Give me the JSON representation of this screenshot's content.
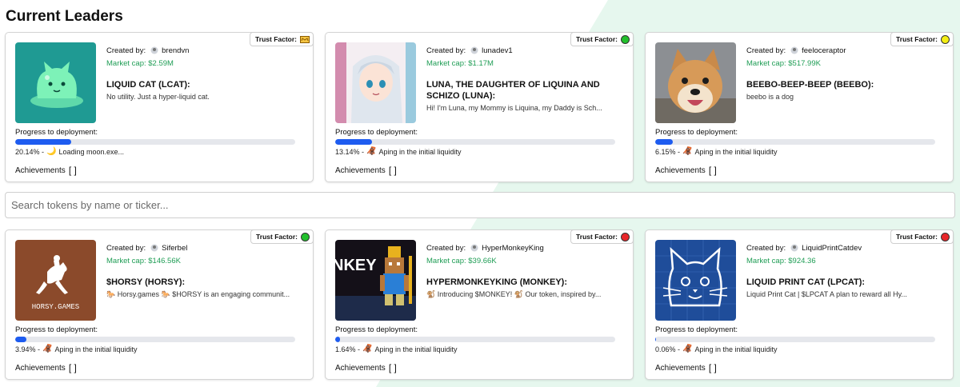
{
  "page": {
    "title": "Current Leaders"
  },
  "search": {
    "placeholder": "Search tokens by name or ticker..."
  },
  "labels": {
    "created_by": "Created by:",
    "trust_factor": "Trust Factor:",
    "progress": "Progress to deployment:",
    "achievements": "Achievements",
    "achievements_value": "[ ]"
  },
  "cards": [
    {
      "creator": "brendvn",
      "market_cap": "Market cap: $2.59M",
      "name": "LIQUID CAT (LCAT):",
      "description": "No utility. Just a hyper-liquid cat.",
      "progress": 20.14,
      "progress_text": "20.14% - ",
      "status_emoji": "🌙",
      "status": "Loading moon.exe...",
      "trust": "crown",
      "image": "liquid-cat"
    },
    {
      "creator": "lunadev1",
      "market_cap": "Market cap: $1.17M",
      "name": "LUNA, THE DAUGHTER OF LIQUINA AND SCHIZO (LUNA):",
      "description": "Hi! I'm Luna, my Mommy is Liquina, my Daddy is Sch...",
      "progress": 13.14,
      "progress_text": "13.14% - ",
      "status_emoji": "🦧",
      "status": "Aping in the initial liquidity",
      "trust": "green",
      "image": "anime-girl"
    },
    {
      "creator": "feeloceraptor",
      "market_cap": "Market cap: $517.99K",
      "name": "BEEBO-BEEP-BEEP (BEEBO):",
      "description": "beebo is a dog",
      "progress": 6.15,
      "progress_text": "6.15% - ",
      "status_emoji": "🦧",
      "status": "Aping in the initial liquidity",
      "trust": "yellow",
      "image": "shiba-dog"
    },
    {
      "creator": "Siferbel",
      "market_cap": "Market cap: $146.56K",
      "name": "$HORSY (HORSY):",
      "description": "🐎 Horsy.games 🐎 $HORSY is an engaging communit...",
      "progress": 3.94,
      "progress_text": "3.94% - ",
      "status_emoji": "🦧",
      "status": "Aping in the initial liquidity",
      "trust": "green",
      "image": "horsy-logo",
      "image_text": "HORSY.GAMES"
    },
    {
      "creator": "HyperMonkeyKing",
      "market_cap": "Market cap: $39.66K",
      "name": "HYPERMONKEYKING (MONKEY):",
      "description": "🐒 Introducing $MONKEY! 🐒 Our token, inspired by...",
      "progress": 1.64,
      "progress_text": "1.64% - ",
      "status_emoji": "🦧",
      "status": "Aping in the initial liquidity",
      "trust": "red",
      "image": "pixel-monkey",
      "image_text": "NKEY"
    },
    {
      "creator": "LiquidPrintCatdev",
      "market_cap": "Market cap: $924.36",
      "name": "LIQUID PRINT CAT (LPCAT):",
      "description": "Liquid Print Cat | $LPCAT A plan to reward all Hy...",
      "progress": 0.06,
      "progress_text": "0.06% - ",
      "status_emoji": "🦧",
      "status": "Aping in the initial liquidity",
      "trust": "red",
      "image": "blueprint-cat"
    }
  ],
  "colors": {
    "accent_green": "#1f9d55",
    "progress_blue": "#1e5cf0",
    "bg_mint": "#e6f7ee"
  }
}
